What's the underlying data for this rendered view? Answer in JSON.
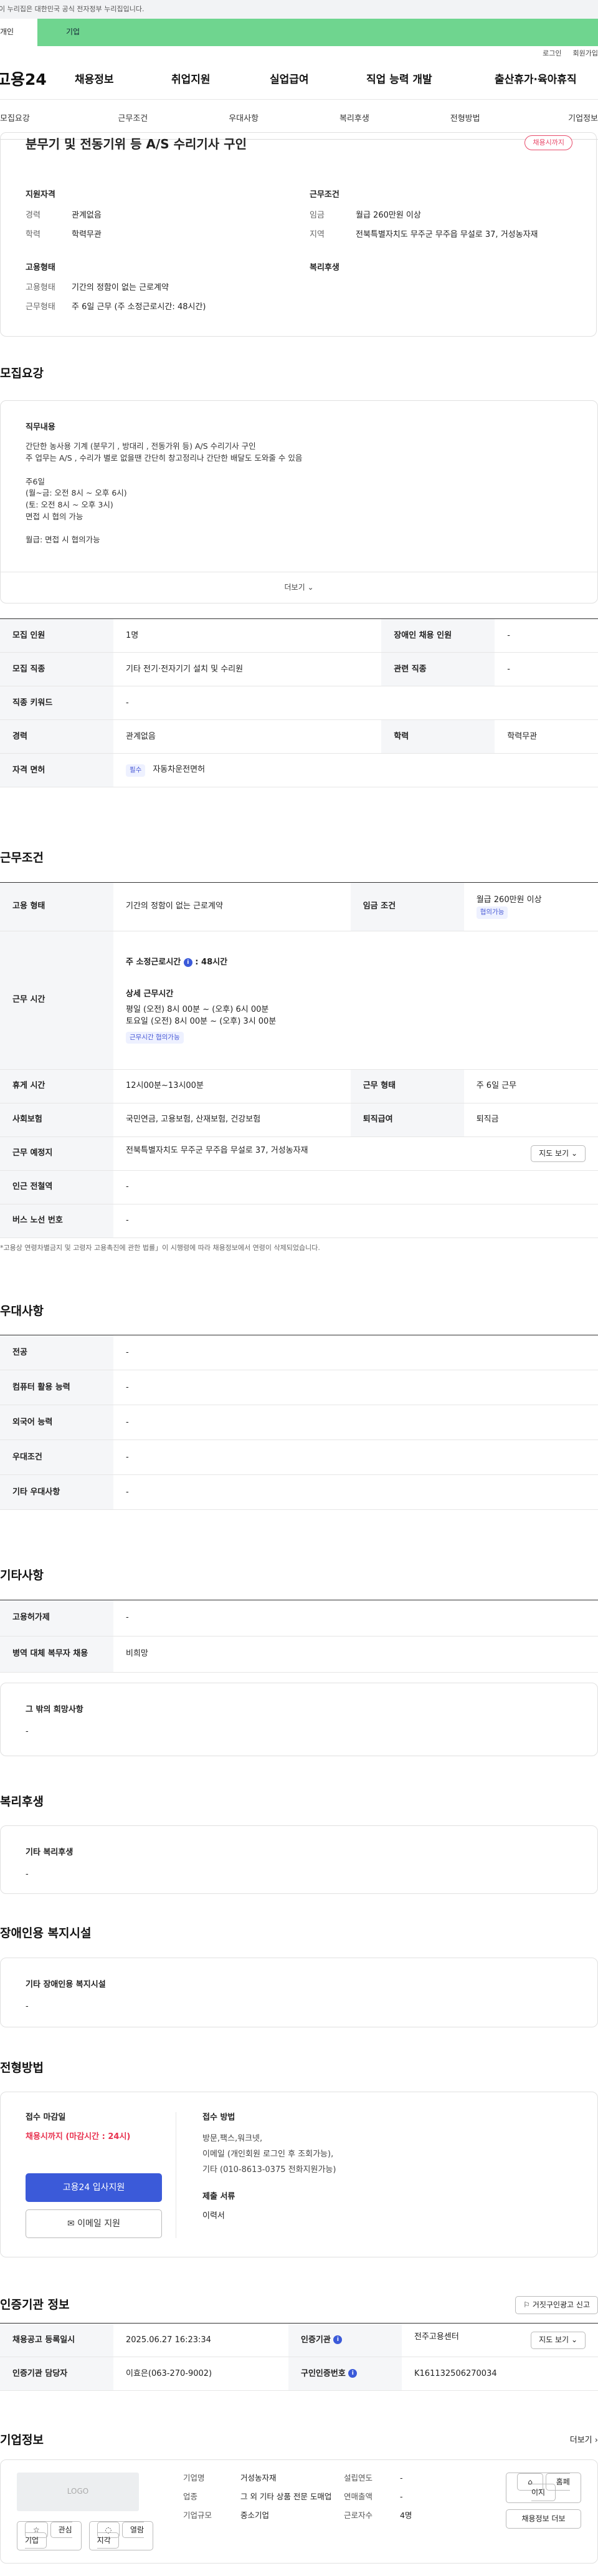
{
  "gov_banner": "이 누리집은 대한민국 공식 전자정부 누리집입니다.",
  "top_tabs": [
    "개인",
    "기업"
  ],
  "util": [
    "로그인",
    "회원가입"
  ],
  "logo": "고용24",
  "gnb": [
    "채용정보",
    "취업지원",
    "실업급여",
    "직업 능력 개발",
    "출산휴가·육아휴직"
  ],
  "subnav": [
    "모집요강",
    "근무조건",
    "우대사항",
    "복리후생",
    "전형방법",
    "기업정보"
  ],
  "job": {
    "title": "분무기 및 전동기위 등 A/S 수리기사 구인",
    "status": "채용시까지",
    "qual": {
      "h": "지원자격",
      "rows": [
        [
          "경력",
          "관계없음"
        ],
        [
          "학력",
          "학력무관"
        ]
      ]
    },
    "cond": {
      "h": "근무조건",
      "rows": [
        [
          "임금",
          "월급 260만원 이상"
        ],
        [
          "지역",
          "전북특별자치도 무주군 무주읍 무설로 37, 거성농자재"
        ]
      ]
    },
    "emp": {
      "h": "고용형태",
      "rows": [
        [
          "고용형태",
          "기간의 정함이 없는 근로계약"
        ],
        [
          "근무형태",
          "주 6일 근무 (주 소정근로시간: 48시간)"
        ]
      ]
    },
    "welfare": {
      "h": "복리후생"
    }
  },
  "recruit": {
    "h": "모집요강",
    "duty_h": "직무내용",
    "duty_text": "간단한 농사용 기계 (분무기 , 방대리 , 전동가위 등) A/S 수리기사 구인\n주 업무는 A/S , 수리가 별로 없을땐 간단히 창고정리나 간단한 배달도 도와줄 수 있음\n\n주6일\n(월~금: 오전 8시 ~ 오후 6시)\n(토: 오전 8시 ~ 오후 3시)\n면접 시 협의 가능\n\n월급: 면접 시 협의가능",
    "more": "더보기",
    "rows": [
      [
        "모집 인원",
        "1명",
        "장애인 채용 인원",
        "-"
      ],
      [
        "모집 직종",
        "기타 전기·전자기기 설치 및 수리원",
        "관련 직종",
        "-"
      ],
      [
        "직종 키워드",
        "-"
      ],
      [
        "경력",
        "관계없음",
        "학력",
        "학력무관"
      ]
    ],
    "license_k": "자격 면허",
    "license_tag": "필수",
    "license_v": "자동차운전면허"
  },
  "work": {
    "h": "근무조건",
    "emp_k": "고용 형태",
    "emp_v": "기간의 정함이 없는 근로계약",
    "wage_k": "임금 조건",
    "wage_v": "월급 260만원 이상",
    "wage_tag": "협의가능",
    "time_k": "근무 시간",
    "time_week": "주 소정근로시간",
    "time_hours": "48시간",
    "time_detail_h": "상세 근무시간",
    "time_l1": "평일 (오전) 8시 00분 ~ (오후) 6시 00분",
    "time_l2": "토요일 (오전) 8시 00분 ~ (오후) 3시 00분",
    "time_tag": "근무시간 협의가능",
    "rows": [
      [
        "휴게 시간",
        "12시00분~13시00분",
        "근무 형태",
        "주 6일 근무"
      ],
      [
        "사회보험",
        "국민연금, 고용보험, 산재보험, 건강보험",
        "퇴직급여",
        "퇴직금"
      ]
    ],
    "place_k": "근무 예정지",
    "place_v": "전북특별자치도 무주군 무주읍 무설로 37, 거성농자재",
    "map": "지도 보기",
    "sub_k": "인근 전철역",
    "sub_v": "-",
    "bus_k": "버스 노선 번호",
    "bus_v": "-",
    "note": "*고용상 연령차별금지 및 고령자 고용촉진에 관한 법률」이 시행령에 따라 채용정보에서 연령이 삭제되었습니다."
  },
  "pref": {
    "h": "우대사항",
    "rows": [
      [
        "전공",
        "-"
      ],
      [
        "컴퓨터 활용 능력",
        "-"
      ],
      [
        "외국어 능력",
        "-"
      ],
      [
        "우대조건",
        "-"
      ],
      [
        "기타 우대사항",
        "-"
      ]
    ]
  },
  "etc": {
    "h": "기타사항",
    "rows": [
      [
        "고용허가제",
        "-"
      ],
      [
        "병역 대체 복무자 채용",
        "비희망"
      ]
    ],
    "box_h": "그 밖의 희망사항",
    "box_v": "-"
  },
  "benefit": {
    "h": "복리후생",
    "box_h": "기타 복리후생",
    "box_v": "-"
  },
  "disab": {
    "h": "장애인용 복지시설",
    "box_h": "기타 장애인용 복지시설",
    "box_v": "-"
  },
  "select": {
    "h": "전형방법",
    "deadline_h": "접수 마감일",
    "deadline": "채용시까지 (마감시간 : 24시)",
    "apply_btn": "고용24 입사지원",
    "mail_btn": "이메일 지원",
    "method_h": "접수 방법",
    "methods": "방문,팩스,워크넷,\n이메일 (개인회원 로그인 후 조회가능),\n기타 (010-8613-0375 전화지원가능)",
    "docs_h": "제출 서류",
    "docs": "이력서"
  },
  "cert": {
    "h": "인증기관 정보",
    "report": "거짓구인광고 신고",
    "rows": [
      [
        "채용공고 등록일시",
        "2025.06.27 16:23:34",
        "인증기관",
        "전주고용센터"
      ],
      [
        "인증기관 담당자",
        "이효은(063-270-9002)",
        "구인인증번호",
        "K161132506270034"
      ]
    ],
    "map": "지도 보기"
  },
  "company": {
    "h": "기업정보",
    "more": "더보기",
    "logo": "LOGO",
    "fav": "관심기업",
    "follow": "열람지각",
    "grid": [
      [
        "기업명",
        "거성농자재",
        "설립연도",
        "-"
      ],
      [
        "업종",
        "그 외 기타 상품 전문 도매업",
        "연매출액",
        "-"
      ],
      [
        "기업규모",
        "중소기업",
        "근로자수",
        "4명"
      ]
    ],
    "home": "홈페이지",
    "jobs": "채용정보 더보"
  }
}
